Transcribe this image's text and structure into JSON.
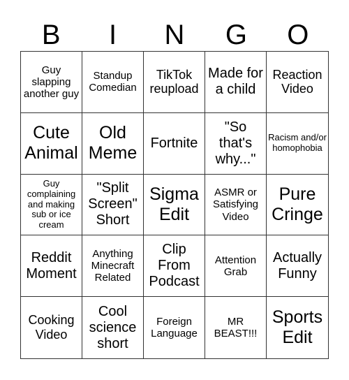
{
  "header": [
    "B",
    "I",
    "N",
    "G",
    "O"
  ],
  "cells": [
    {
      "text": "Guy slapping another guy",
      "size": "sm"
    },
    {
      "text": "Standup Comedian",
      "size": "sm"
    },
    {
      "text": "TikTok reupload",
      "size": "md"
    },
    {
      "text": "Made for a child",
      "size": "lg"
    },
    {
      "text": "Reaction Video",
      "size": "md"
    },
    {
      "text": "Cute Animal",
      "size": "xl"
    },
    {
      "text": "Old Meme",
      "size": "xl"
    },
    {
      "text": "Fortnite",
      "size": "lg"
    },
    {
      "text": "\"So that's why...\"",
      "size": "lg"
    },
    {
      "text": "Racism and/or homophobia",
      "size": "xs"
    },
    {
      "text": "Guy complaining and making sub or ice cream",
      "size": "xs"
    },
    {
      "text": "\"Split Screen\" Short",
      "size": "lg"
    },
    {
      "text": "Sigma Edit",
      "size": "xl"
    },
    {
      "text": "ASMR or Satisfying Video",
      "size": "sm"
    },
    {
      "text": "Pure Cringe",
      "size": "xl"
    },
    {
      "text": "Reddit Moment",
      "size": "lg"
    },
    {
      "text": "Anything Minecraft Related",
      "size": "sm"
    },
    {
      "text": "Clip From Podcast",
      "size": "lg"
    },
    {
      "text": "Attention Grab",
      "size": "sm"
    },
    {
      "text": "Actually Funny",
      "size": "lg"
    },
    {
      "text": "Cooking Video",
      "size": "md"
    },
    {
      "text": "Cool science short",
      "size": "lg"
    },
    {
      "text": "Foreign Language",
      "size": "sm"
    },
    {
      "text": "MR BEAST!!!",
      "size": "sm"
    },
    {
      "text": "Sports Edit",
      "size": "xl"
    }
  ]
}
